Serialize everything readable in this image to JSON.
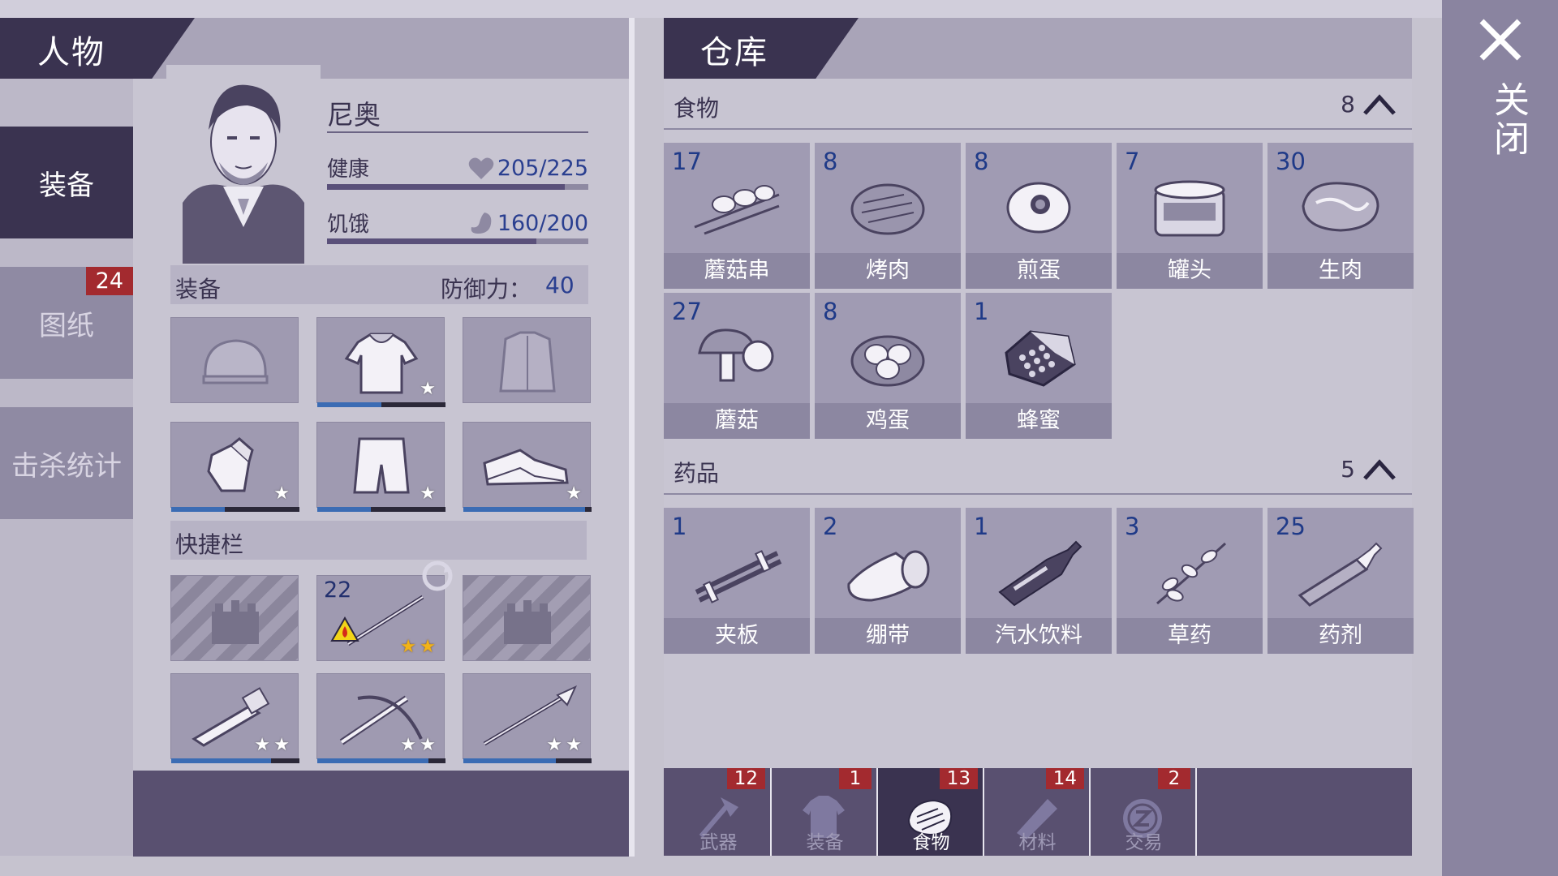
{
  "character_panel": {
    "title": "人物",
    "nav": [
      {
        "label": "装备",
        "active": true
      },
      {
        "label": "图纸",
        "badge": "24"
      },
      {
        "label": "击杀统计"
      }
    ],
    "name": "尼奥",
    "stats": [
      {
        "label": "健康",
        "icon": "heart-icon",
        "value": "205/225",
        "fraction": 0.91
      },
      {
        "label": "饥饿",
        "icon": "stomach-icon",
        "value": "160/200",
        "fraction": 0.8
      }
    ],
    "equipment_section": {
      "title": "装备",
      "defense_label": "防御力：",
      "defense_value": "40"
    },
    "equipment_slots": [
      {
        "icon": "beanie-hat-icon",
        "stars": 0,
        "durability": null
      },
      {
        "icon": "hooded-shirt-icon",
        "stars": 1,
        "durability": 0.5
      },
      {
        "icon": "jacket-icon",
        "stars": 0,
        "durability": null
      },
      {
        "icon": "gloves-icon",
        "stars": 1,
        "durability": 0.42
      },
      {
        "icon": "shorts-icon",
        "stars": 1,
        "durability": 0.42
      },
      {
        "icon": "boots-icon",
        "stars": 1,
        "durability": 0.95
      }
    ],
    "quickbar_section": {
      "title": "快捷栏"
    },
    "quickbar_slots": [
      {
        "icon": "locked-slot-icon",
        "locked": true
      },
      {
        "icon": "torch-spear-icon",
        "count": "22",
        "stars": 2,
        "gold": true,
        "fire": true
      },
      {
        "icon": "locked-slot-icon",
        "locked": true
      },
      {
        "icon": "chainsaw-rifle-icon",
        "stars": 2,
        "durability": 0.78
      },
      {
        "icon": "crossbow-icon",
        "stars": 2,
        "durability": 0.87
      },
      {
        "icon": "spear-icon",
        "stars": 2,
        "durability": 0.72
      }
    ]
  },
  "warehouse_panel": {
    "title": "仓库",
    "categories": [
      {
        "title": "食物",
        "count": "8",
        "items": [
          {
            "count": "17",
            "label": "蘑菇串",
            "icon": "mushroom-skewer-icon"
          },
          {
            "count": "8",
            "label": "烤肉",
            "icon": "grilled-meat-icon"
          },
          {
            "count": "8",
            "label": "煎蛋",
            "icon": "fried-egg-icon"
          },
          {
            "count": "7",
            "label": "罐头",
            "icon": "canned-food-icon"
          },
          {
            "count": "30",
            "label": "生肉",
            "icon": "raw-meat-icon"
          },
          {
            "count": "27",
            "label": "蘑菇",
            "icon": "mushroom-icon"
          },
          {
            "count": "8",
            "label": "鸡蛋",
            "icon": "eggs-nest-icon"
          },
          {
            "count": "1",
            "label": "蜂蜜",
            "icon": "honeycomb-icon"
          }
        ]
      },
      {
        "title": "药品",
        "count": "5",
        "items": [
          {
            "count": "1",
            "label": "夹板",
            "icon": "splint-icon"
          },
          {
            "count": "2",
            "label": "绷带",
            "icon": "bandage-icon"
          },
          {
            "count": "1",
            "label": "汽水饮料",
            "icon": "soda-bottle-icon"
          },
          {
            "count": "3",
            "label": "草药",
            "icon": "herb-icon"
          },
          {
            "count": "25",
            "label": "药剂",
            "icon": "syringe-icon"
          }
        ]
      }
    ],
    "tabs": [
      {
        "label": "武器",
        "badge": "12",
        "icon": "axe-icon"
      },
      {
        "label": "装备",
        "badge": "1",
        "icon": "shirt-icon"
      },
      {
        "label": "食物",
        "badge": "13",
        "icon": "meat-icon",
        "active": true
      },
      {
        "label": "材料",
        "badge": "14",
        "icon": "log-icon"
      },
      {
        "label": "交易",
        "badge": "2",
        "icon": "coin-icon"
      }
    ]
  },
  "close": {
    "label": "关闭"
  },
  "colors": {
    "accent": "#3a3350",
    "badge": "#a32a2f",
    "count_blue": "#1f3a88",
    "durability": "#3b6cb4",
    "gold_star": "#f2b318"
  }
}
